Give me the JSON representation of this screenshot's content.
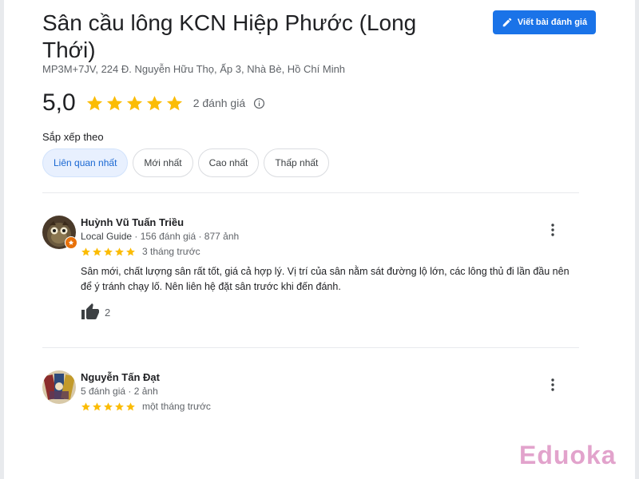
{
  "place": {
    "title": "Sân cầu lông KCN Hiệp Phước (Long Thới)",
    "address": "MP3M+7JV, 224 Đ. Nguyễn Hữu Thọ, Ấp 3, Nhà Bè, Hồ Chí Minh",
    "write_review_label": "Viết bài đánh giá"
  },
  "rating": {
    "value": "5,0",
    "stars": 5,
    "count_label": "2 đánh giá"
  },
  "sort": {
    "label": "Sắp xếp theo",
    "options": [
      "Liên quan nhất",
      "Mới nhất",
      "Cao nhất",
      "Thấp nhất"
    ],
    "selected": "Liên quan nhất"
  },
  "reviews": [
    {
      "name": "Huỳnh Vũ Tuấn Triều",
      "guide": "Local Guide",
      "meta": "156 đánh giá · 877 ảnh",
      "stars": 5,
      "date": "3 tháng trước",
      "text": "Sân mới, chất lượng sân rất tốt, giá cả hợp lý. Vị trí của sân nằm sát đường lộ lớn, các lông thủ đi lần đầu nên để ý tránh chạy lố. Nên liên hệ đặt sân trước khi đến đánh.",
      "likes": "2"
    },
    {
      "name": "Nguyễn Tấn Đạt",
      "meta": "5 đánh giá · 2 ảnh",
      "stars": 5,
      "date": "một tháng trước"
    }
  ],
  "watermark": "Eduoka",
  "colors": {
    "accent": "#1a73e8",
    "star": "#fbbc04",
    "chip_active_bg": "#e8f0fe",
    "watermark": "#e2a3cc"
  },
  "icons": [
    "pencil-icon",
    "star-icon",
    "info-icon",
    "thumbs-up-icon",
    "more-vert-icon"
  ]
}
